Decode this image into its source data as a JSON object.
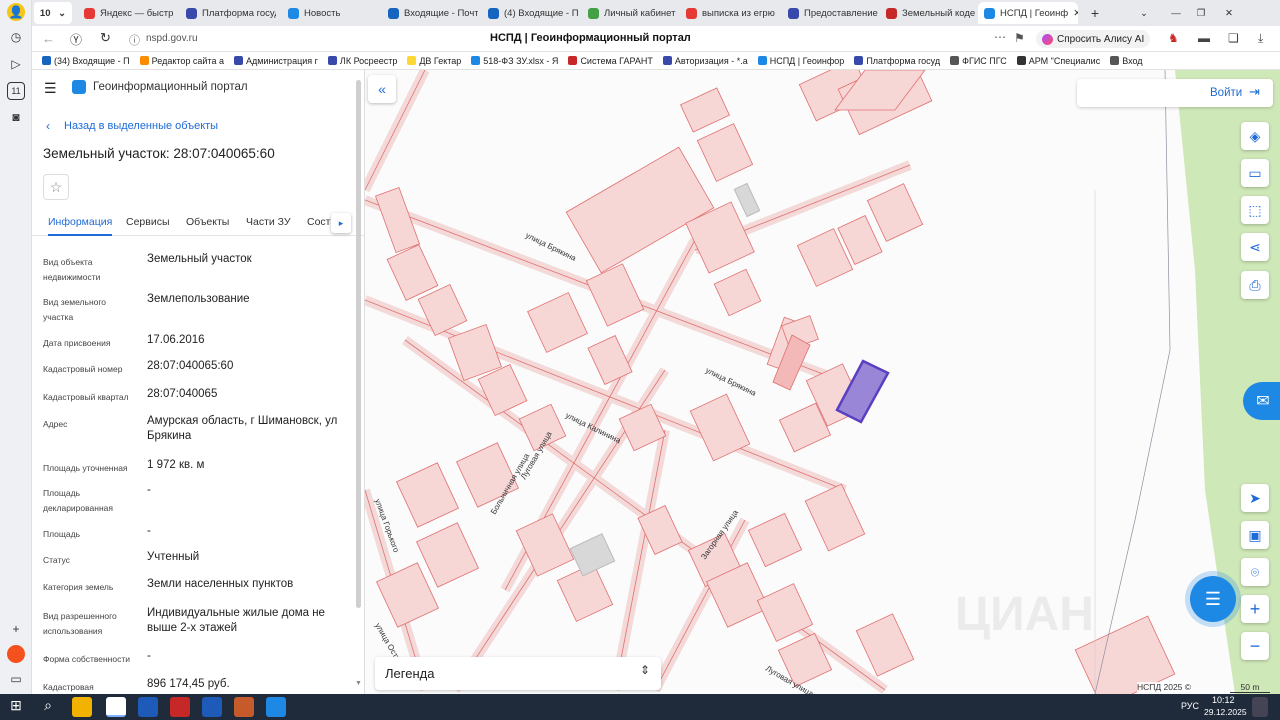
{
  "browser": {
    "tab_count": "10",
    "tabs": [
      {
        "label": "Яндекс — быстр",
        "color": "#e53935"
      },
      {
        "label": "Платформа госуд",
        "color": "#3949ab"
      },
      {
        "label": "Новость",
        "color": "#1e88e5"
      },
      {
        "label": "Входящие - Почт",
        "color": "#1565c0"
      },
      {
        "label": "(4) Входящие - П",
        "color": "#1565c0"
      },
      {
        "label": "Личный кабинет",
        "color": "#43a047"
      },
      {
        "label": "выписка из егрю",
        "color": "#e53935"
      },
      {
        "label": "Предоставление",
        "color": "#3949ab"
      },
      {
        "label": "Земельный коде",
        "color": "#c62828"
      },
      {
        "label": "НСПД | Геоинф",
        "color": "#1e88e5"
      }
    ],
    "url": "nspd.gov.ru",
    "page_title": "НСПД | Геоинформационный портал",
    "alice_label": "Спросить Алису AI",
    "profile_label": "Войти",
    "bookmarks": [
      {
        "label": "(34) Входящие - П",
        "color": "#1565c0"
      },
      {
        "label": "Редактор сайта а",
        "color": "#fb8c00"
      },
      {
        "label": "Администрация г",
        "color": "#3949ab"
      },
      {
        "label": "ЛК Росреестр",
        "color": "#3949ab"
      },
      {
        "label": "ДВ Гектар",
        "color": "#fdd835"
      },
      {
        "label": "518-ФЗ ЗУ.xlsx - Я",
        "color": "#1e88e5"
      },
      {
        "label": "Система ГАРАНТ",
        "color": "#c62828"
      },
      {
        "label": "Авторизация - *.а",
        "color": "#3949ab"
      },
      {
        "label": "НСПД | Геоинфор",
        "color": "#1e88e5"
      },
      {
        "label": "Платформа госуд",
        "color": "#3949ab"
      },
      {
        "label": "ФГИС ПГС",
        "color": "#555555"
      },
      {
        "label": "АРМ \"Специалис",
        "color": "#333333"
      },
      {
        "label": "Вход",
        "color": "#555555"
      }
    ]
  },
  "portal": {
    "title": "Геоинформационный портал",
    "back_link": "Назад в выделенные объекты",
    "object_title": "Земельный участок: 28:07:040065:60",
    "tabs": [
      "Информация",
      "Сервисы",
      "Объекты",
      "Части ЗУ",
      "Соста"
    ],
    "active_tab": "Информация",
    "fields": [
      {
        "label": "Вид объекта недвижимости",
        "value": "Земельный участок"
      },
      {
        "label": "Вид земельного участка",
        "value": "Землепользование"
      },
      {
        "label": "Дата присвоения",
        "value": "17.06.2016"
      },
      {
        "label": "Кадастровый номер",
        "value": "28:07:040065:60"
      },
      {
        "label": "Кадастровый квартал",
        "value": "28:07:040065"
      },
      {
        "label": "Адрес",
        "value": "Амурская область, г Шимановск, ул Брякина"
      },
      {
        "label": "Площадь уточненная",
        "value": "1 972 кв. м"
      },
      {
        "label": "Площадь декларированная",
        "value": "-"
      },
      {
        "label": "Площадь",
        "value": "-"
      },
      {
        "label": "Статус",
        "value": "Учтенный"
      },
      {
        "label": "Категория земель",
        "value": "Земли населенных пунктов"
      },
      {
        "label": "Вид разрешенного использования",
        "value": "Индивидуальные жилые дома не выше 2-х этажей"
      },
      {
        "label": "Форма собственности",
        "value": "-"
      },
      {
        "label": "Кадастровая",
        "value": "896 174,45 руб."
      }
    ]
  },
  "map": {
    "login_label": "Войти",
    "legend_label": "Легенда",
    "copyright": "НСПД 2025 ©",
    "scale_label": "50 m",
    "streets": [
      "улица Брякина",
      "улица Брякина",
      "улица Калинина",
      "Луговая улица",
      "Больничная улица",
      "Загорная улица",
      "Луговая улица",
      "улица Горького",
      "улица Островс"
    ],
    "watermark": "ЦИАН",
    "colors": {
      "parcel_stroke": "#e07070",
      "parcel_fill": "#f7d6d6",
      "selected_fill": "#9a86d6",
      "selected_stroke": "#5a3fc0",
      "accent": "#1e6ad6"
    }
  },
  "taskbar": {
    "lang": "РУС",
    "time": "10:12",
    "date": "29.12.2025"
  }
}
